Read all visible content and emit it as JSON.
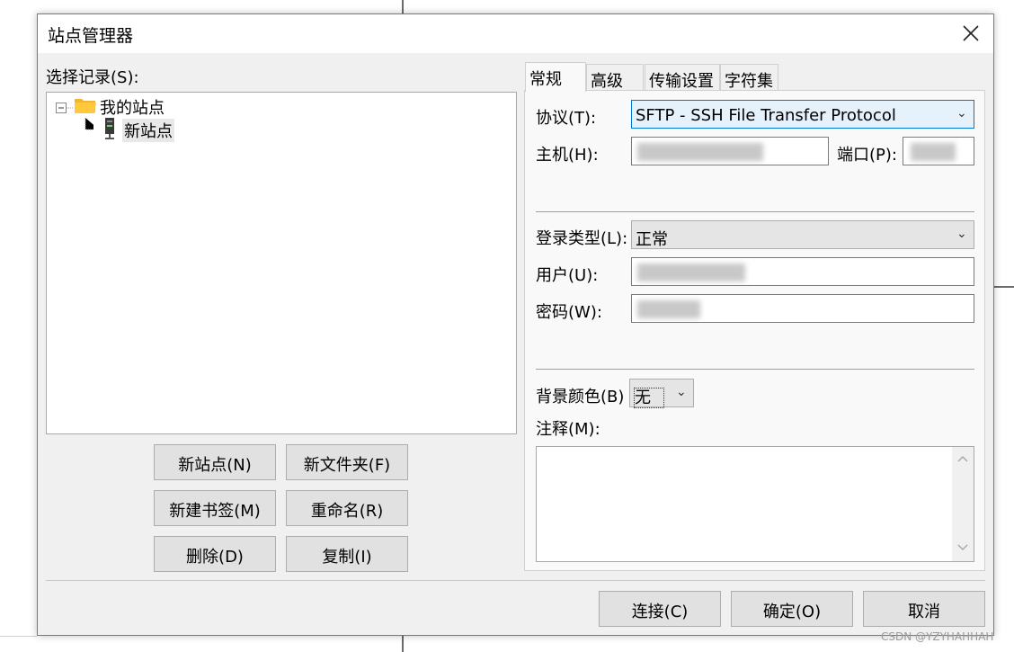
{
  "window": {
    "title": "站点管理器"
  },
  "left": {
    "select_label": "选择记录(S):",
    "tree": {
      "root": "我的站点",
      "child": "新站点"
    },
    "buttons": {
      "new_site": "新站点(N)",
      "new_folder": "新文件夹(F)",
      "new_bookmark": "新建书签(M)",
      "rename": "重命名(R)",
      "delete": "删除(D)",
      "copy": "复制(I)"
    }
  },
  "tabs": [
    "常规",
    "高级",
    "传输设置",
    "字符集"
  ],
  "general": {
    "protocol_label": "协议(T):",
    "protocol_value": "SFTP - SSH File Transfer Protocol",
    "host_label": "主机(H):",
    "port_label": "端口(P):",
    "logon_type_label": "登录类型(L):",
    "logon_type_value": "正常",
    "user_label": "用户(U):",
    "password_label": "密码(W):",
    "bg_color_label": "背景颜色(B)",
    "bg_color_value": "无",
    "comments_label": "注释(M):"
  },
  "footer": {
    "connect": "连接(C)",
    "ok": "确定(O)",
    "cancel": "取消"
  },
  "watermark": "CSDN @YZYHAHHAH"
}
